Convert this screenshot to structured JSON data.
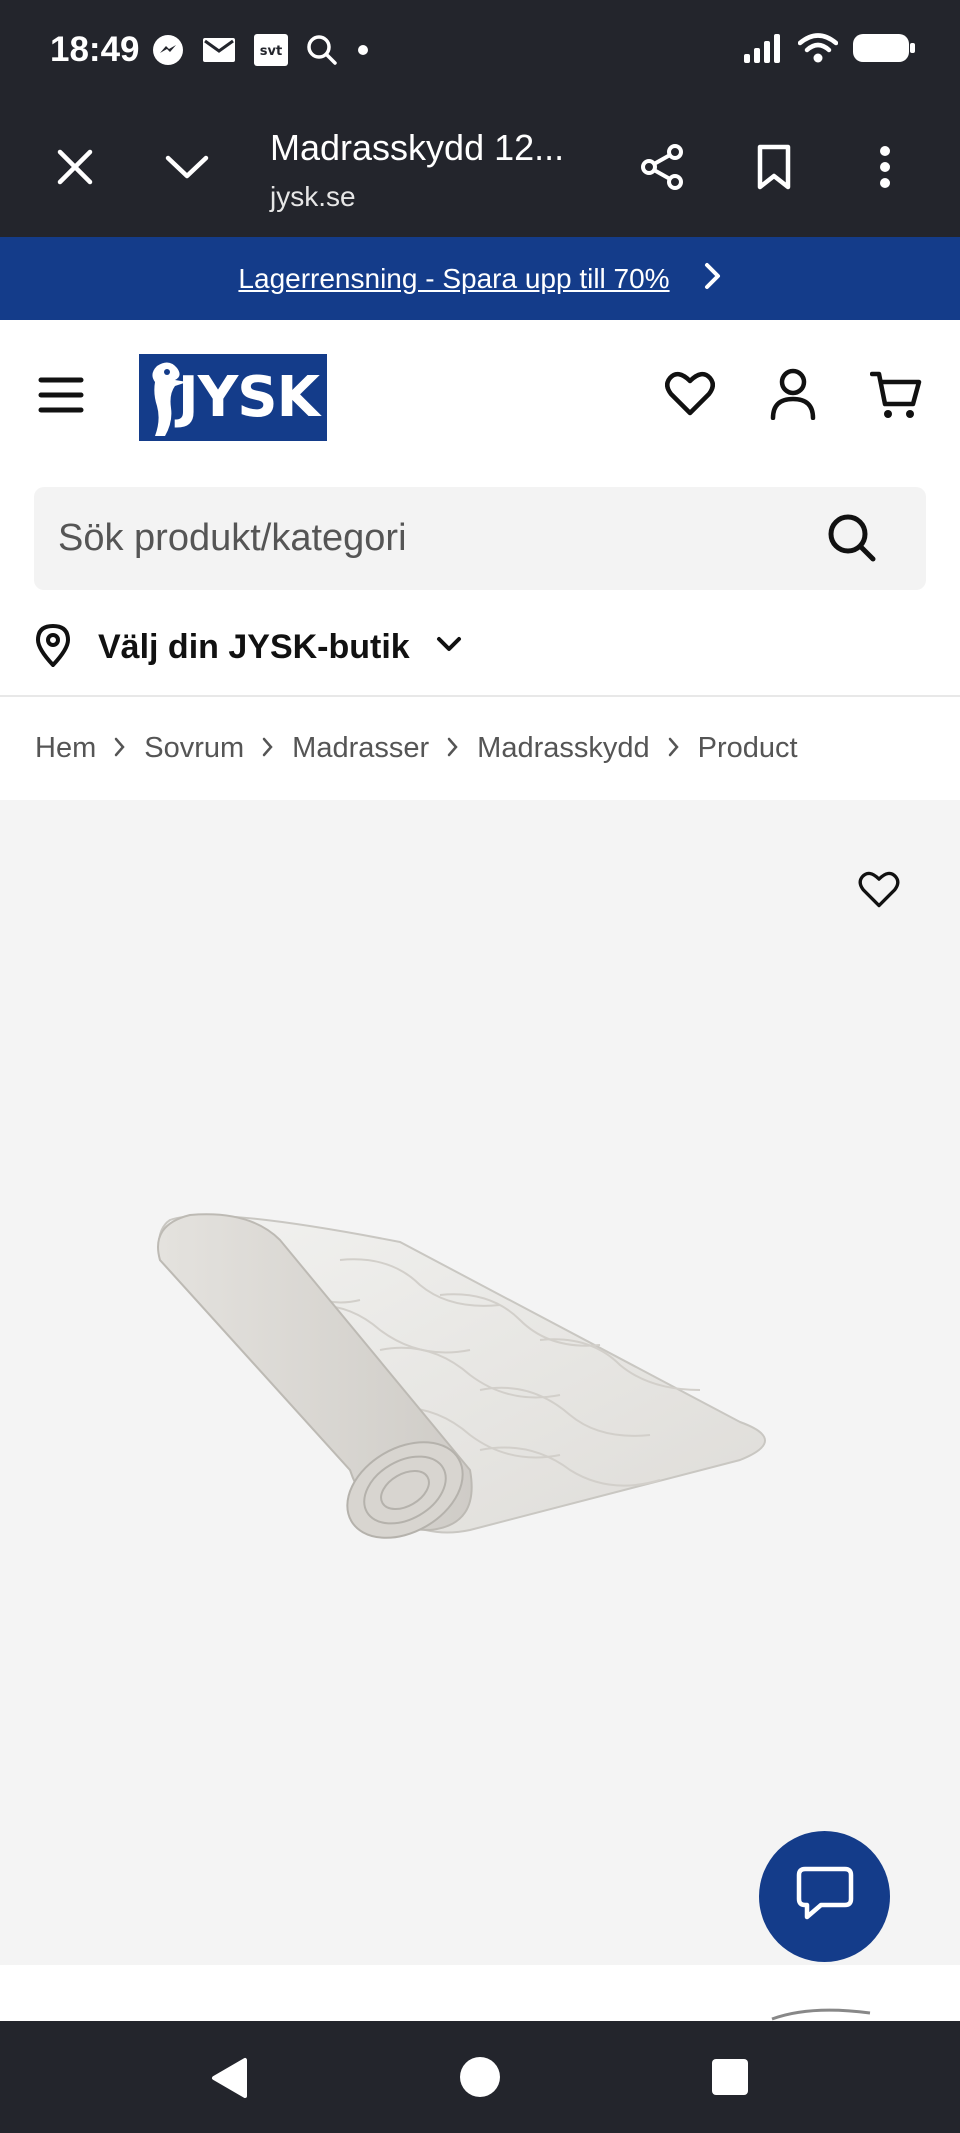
{
  "status_bar": {
    "time": "18:49"
  },
  "browser": {
    "title": "Madrasskydd 12...",
    "url": "jysk.se"
  },
  "promo": {
    "text": "Lagerrensning - Spara upp till 70%"
  },
  "header": {
    "logo_text": "JYSK"
  },
  "search": {
    "placeholder": "Sök produkt/kategori"
  },
  "store": {
    "label": "Välj din JYSK-butik"
  },
  "breadcrumb": {
    "items": [
      "Hem",
      "Sovrum",
      "Madrasser",
      "Madrasskydd",
      "Product"
    ]
  },
  "colors": {
    "brand_blue": "#143c8a",
    "system_bar": "#23252c",
    "product_bg": "#f4f4f4"
  },
  "icons": {
    "status_left": [
      "messenger-icon",
      "gmail-icon",
      "svt-icon",
      "search-icon",
      "dot-icon"
    ],
    "status_right": [
      "signal-icon",
      "wifi-icon",
      "battery-icon"
    ],
    "browser": [
      "close-icon",
      "chevron-down-icon",
      "share-icon",
      "bookmark-icon",
      "more-vert-icon"
    ],
    "header": [
      "menu-icon",
      "heart-icon",
      "user-icon",
      "cart-icon"
    ],
    "nav": [
      "back-icon",
      "home-icon",
      "recents-icon"
    ]
  }
}
